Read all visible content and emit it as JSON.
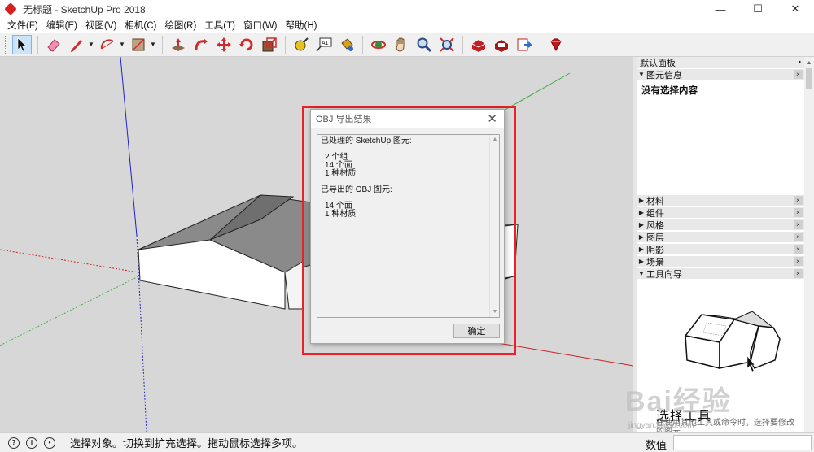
{
  "window": {
    "title": "无标题 - SketchUp Pro 2018",
    "minimize": "—",
    "maximize": "☐",
    "close": "✕"
  },
  "menu": [
    "文件(F)",
    "编辑(E)",
    "视图(V)",
    "相机(C)",
    "绘图(R)",
    "工具(T)",
    "窗口(W)",
    "帮助(H)"
  ],
  "toolbar": {
    "tools": [
      "select-tool",
      "eraser-tool",
      "pencil-tool",
      "arc-tool",
      "rectangle-tool",
      "push-pull-tool",
      "follow-me-tool",
      "move-tool",
      "rotate-tool",
      "scale-tool",
      "tape-measure-tool",
      "text-tool",
      "paint-bucket-tool",
      "orbit-tool",
      "pan-tool",
      "zoom-tool",
      "zoom-extents-tool",
      "warehouse-tool",
      "extension-warehouse-tool",
      "layout-tool",
      "ruby-tool"
    ],
    "text_tool_label": "A1"
  },
  "dialog": {
    "title": "OBJ 导出结果",
    "close": "✕",
    "processed_heading": "已处理的 SketchUp 图元:",
    "processed_items": [
      "2 个组",
      "14 个面",
      "1 种材质"
    ],
    "exported_heading": "已导出的 OBJ 图元:",
    "exported_items": [
      "14 个面",
      "1 种材质"
    ],
    "ok_label": "确定",
    "scroll_up": "▲",
    "scroll_down": "▼"
  },
  "panel": {
    "title": "默认面板",
    "pin": "▪",
    "entity_section": "图元信息",
    "entity_info": "没有选择内容",
    "collapsed_sections": [
      "材料",
      "组件",
      "风格",
      "图层",
      "阴影",
      "场景"
    ],
    "instructor_section": "工具向导",
    "close_glyph": "×",
    "expanded_glyph": "▼",
    "collapsed_glyph": "▶",
    "instructor_title": "选择工具",
    "instructor_desc": "在使用其他工具或命令时，选择要修改的图元。"
  },
  "status": {
    "message": "选择对象。切换到扩充选择。拖动鼠标选择多项。",
    "measure_label": "数值",
    "measure_value": ""
  },
  "watermark": {
    "text": "Bai经验",
    "sub": "jingyan.baidu.com"
  },
  "colors": {
    "accent_red": "#e8212a",
    "viewport_bg": "#d7d7d7",
    "axis_green": "#3cb043",
    "axis_red": "#d02020",
    "axis_blue": "#2020d0"
  }
}
